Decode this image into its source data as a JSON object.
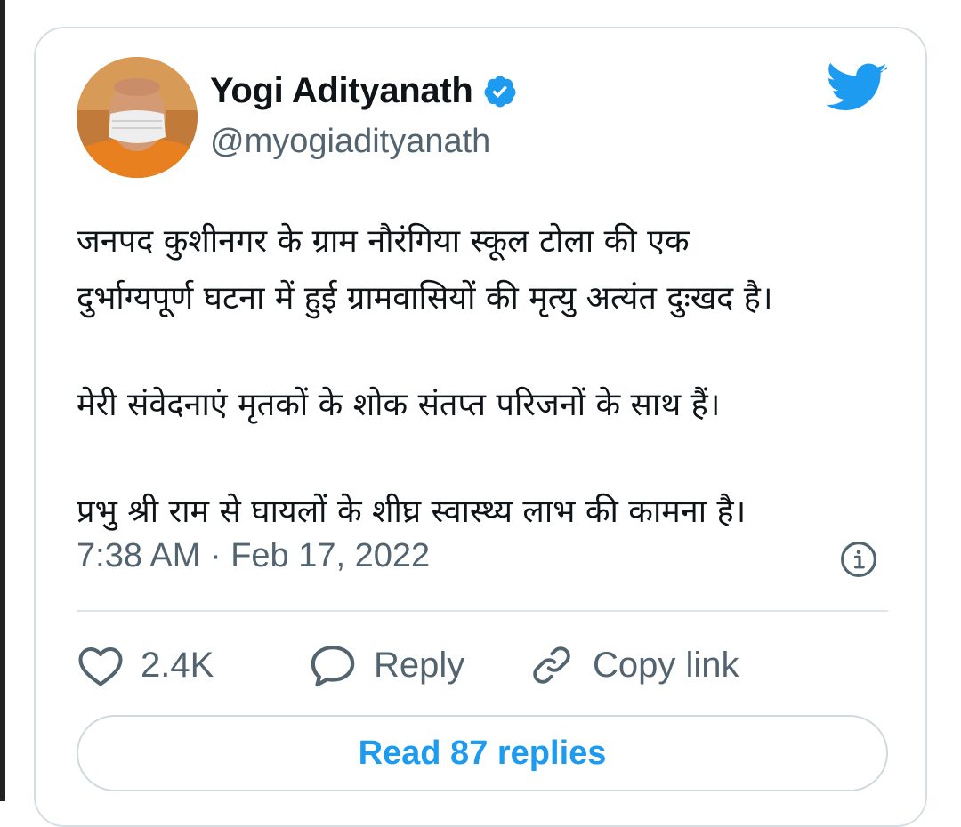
{
  "tweet": {
    "author_name": "Yogi Adityanath",
    "handle": "@myogiadityanath",
    "paragraphs": [
      [
        "जनपद कुशीनगर के ग्राम नौरंगिया स्कूल टोला की एक",
        "दुर्भाग्यपूर्ण घटना में हुई ग्रामवासियों की मृत्यु अत्यंत दुःखद है।"
      ],
      [
        "मेरी संवेदनाएं मृतकों के शोक संतप्त परिजनों के साथ हैं।"
      ],
      [
        "प्रभु श्री राम से घायलों के शीघ्र स्वास्थ्य लाभ की कामना है।"
      ]
    ],
    "timestamp": "7:38 AM · Feb 17, 2022"
  },
  "actions": {
    "like_count": "2.4K",
    "reply_label": "Reply",
    "copy_link_label": "Copy link"
  },
  "read_replies_label": "Read 87 replies",
  "icons": {
    "avatar": "avatar",
    "verified": "verified-badge-icon",
    "brand": "twitter-bird-icon",
    "info": "info-icon",
    "like": "heart-icon",
    "reply": "speech-bubble-icon",
    "copy_link": "link-icon"
  },
  "colors": {
    "brand_blue": "#1d9bf0",
    "muted_text": "#536471",
    "border": "#cfd9de"
  }
}
